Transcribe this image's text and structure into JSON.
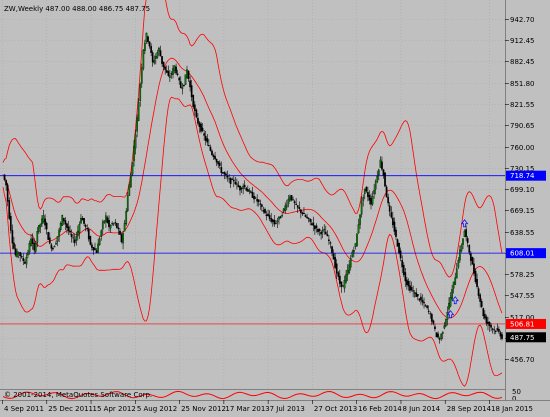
{
  "header": {
    "symbol_line": "ZW,Weekly  487.00 488.00 486.75 487.75"
  },
  "copyright": "© 2001-2014, MetaQuotes Software Corp.",
  "colors": {
    "background": "#c0c0c0",
    "candle_body": "#008000",
    "candle_wick": "#000000",
    "bollinger": "#ff0000",
    "level_line": "#0000ff",
    "price_tag_bg": "#0000ff",
    "current_price_tag_bg": "#000000",
    "red_tag_bg": "#ff0000",
    "indicator_line": "#ff0000"
  },
  "price_axis": {
    "ticks": [
      "942.70",
      "912.45",
      "882.45",
      "851.80",
      "821.55",
      "790.65",
      "760.00",
      "730.15",
      "699.10",
      "669.15",
      "638.55",
      "608.00",
      "578.25",
      "547.55",
      "517.00",
      "486.75",
      "456.70"
    ]
  },
  "time_axis": {
    "ticks": [
      "4 Sep 2011",
      "25 Dec 2011",
      "15 Apr 2012",
      "5 Aug 2012",
      "25 Nov 2012",
      "17 Mar 2013",
      "7 Jul 2013",
      "27 Oct 2013",
      "16 Feb 2014",
      "8 Jun 2014",
      "28 Sep 2014",
      "18 Jan 2015"
    ]
  },
  "indicator_axis": {
    "labels": [
      "50",
      "0"
    ]
  },
  "tags": {
    "upper_level": "718.74",
    "lower_level": "608.01",
    "red_level": "506.81",
    "current_price": "487.75"
  },
  "chart_data": {
    "type": "candlestick",
    "instrument": "ZW",
    "timeframe": "Weekly",
    "ohlc_last": {
      "open": 487.0,
      "high": 488.0,
      "low": 486.75,
      "close": 487.75
    },
    "ylim": [
      456.7,
      942.7
    ],
    "horizontal_levels": [
      718.74,
      608.01,
      506.81
    ],
    "close_series": [
      [
        0,
        720
      ],
      [
        2,
        705
      ],
      [
        4,
        660
      ],
      [
        6,
        625
      ],
      [
        8,
        605
      ],
      [
        10,
        610
      ],
      [
        12,
        600
      ],
      [
        14,
        595
      ],
      [
        16,
        610
      ],
      [
        18,
        630
      ],
      [
        20,
        610
      ],
      [
        22,
        640
      ],
      [
        24,
        650
      ],
      [
        26,
        660
      ],
      [
        28,
        640
      ],
      [
        30,
        620
      ],
      [
        32,
        615
      ],
      [
        34,
        625
      ],
      [
        36,
        640
      ],
      [
        38,
        660
      ],
      [
        40,
        650
      ],
      [
        42,
        640
      ],
      [
        44,
        630
      ],
      [
        46,
        625
      ],
      [
        48,
        640
      ],
      [
        50,
        660
      ],
      [
        52,
        650
      ],
      [
        54,
        640
      ],
      [
        56,
        620
      ],
      [
        58,
        615
      ],
      [
        60,
        610
      ],
      [
        62,
        630
      ],
      [
        64,
        650
      ],
      [
        66,
        660
      ],
      [
        68,
        645
      ],
      [
        70,
        650
      ],
      [
        72,
        650
      ],
      [
        74,
        640
      ],
      [
        76,
        625
      ],
      [
        78,
        650
      ],
      [
        80,
        690
      ],
      [
        82,
        720
      ],
      [
        84,
        760
      ],
      [
        86,
        800
      ],
      [
        88,
        850
      ],
      [
        90,
        900
      ],
      [
        92,
        920
      ],
      [
        94,
        905
      ],
      [
        96,
        880
      ],
      [
        98,
        890
      ],
      [
        100,
        900
      ],
      [
        102,
        880
      ],
      [
        104,
        870
      ],
      [
        106,
        860
      ],
      [
        108,
        865
      ],
      [
        110,
        875
      ],
      [
        112,
        860
      ],
      [
        114,
        845
      ],
      [
        116,
        850
      ],
      [
        118,
        870
      ],
      [
        120,
        845
      ],
      [
        122,
        820
      ],
      [
        124,
        800
      ],
      [
        126,
        790
      ],
      [
        128,
        780
      ],
      [
        130,
        770
      ],
      [
        132,
        760
      ],
      [
        134,
        750
      ],
      [
        136,
        745
      ],
      [
        138,
        735
      ],
      [
        140,
        725
      ],
      [
        142,
        720
      ],
      [
        144,
        715
      ],
      [
        146,
        710
      ],
      [
        148,
        712
      ],
      [
        150,
        705
      ],
      [
        152,
        700
      ],
      [
        154,
        705
      ],
      [
        156,
        700
      ],
      [
        158,
        695
      ],
      [
        160,
        690
      ],
      [
        162,
        685
      ],
      [
        164,
        680
      ],
      [
        166,
        672
      ],
      [
        168,
        665
      ],
      [
        170,
        660
      ],
      [
        172,
        655
      ],
      [
        174,
        650
      ],
      [
        176,
        655
      ],
      [
        178,
        660
      ],
      [
        180,
        670
      ],
      [
        182,
        680
      ],
      [
        184,
        690
      ],
      [
        186,
        682
      ],
      [
        188,
        675
      ],
      [
        190,
        670
      ],
      [
        192,
        665
      ],
      [
        194,
        660
      ],
      [
        196,
        655
      ],
      [
        198,
        650
      ],
      [
        200,
        645
      ],
      [
        202,
        640
      ],
      [
        204,
        638
      ],
      [
        206,
        640
      ],
      [
        208,
        630
      ],
      [
        210,
        620
      ],
      [
        212,
        600
      ],
      [
        214,
        580
      ],
      [
        216,
        565
      ],
      [
        218,
        560
      ],
      [
        220,
        575
      ],
      [
        222,
        590
      ],
      [
        224,
        610
      ],
      [
        226,
        620
      ],
      [
        228,
        650
      ],
      [
        230,
        680
      ],
      [
        232,
        700
      ],
      [
        234,
        690
      ],
      [
        236,
        680
      ],
      [
        238,
        700
      ],
      [
        240,
        720
      ],
      [
        242,
        740
      ],
      [
        244,
        720
      ],
      [
        246,
        690
      ],
      [
        248,
        665
      ],
      [
        250,
        650
      ],
      [
        252,
        630
      ],
      [
        254,
        610
      ],
      [
        256,
        590
      ],
      [
        258,
        570
      ],
      [
        260,
        560
      ],
      [
        262,
        555
      ],
      [
        264,
        550
      ],
      [
        266,
        545
      ],
      [
        268,
        540
      ],
      [
        270,
        535
      ],
      [
        272,
        528
      ],
      [
        274,
        520
      ],
      [
        276,
        505
      ],
      [
        278,
        490
      ],
      [
        280,
        485
      ],
      [
        282,
        498
      ],
      [
        284,
        515
      ],
      [
        286,
        535
      ],
      [
        288,
        555
      ],
      [
        290,
        575
      ],
      [
        292,
        600
      ],
      [
        294,
        620
      ],
      [
        296,
        640
      ],
      [
        298,
        620
      ],
      [
        300,
        600
      ],
      [
        302,
        580
      ],
      [
        304,
        560
      ],
      [
        306,
        540
      ],
      [
        308,
        520
      ],
      [
        310,
        510
      ],
      [
        312,
        505
      ],
      [
        314,
        500
      ],
      [
        316,
        498
      ],
      [
        318,
        495
      ],
      [
        320,
        487.75
      ]
    ]
  }
}
